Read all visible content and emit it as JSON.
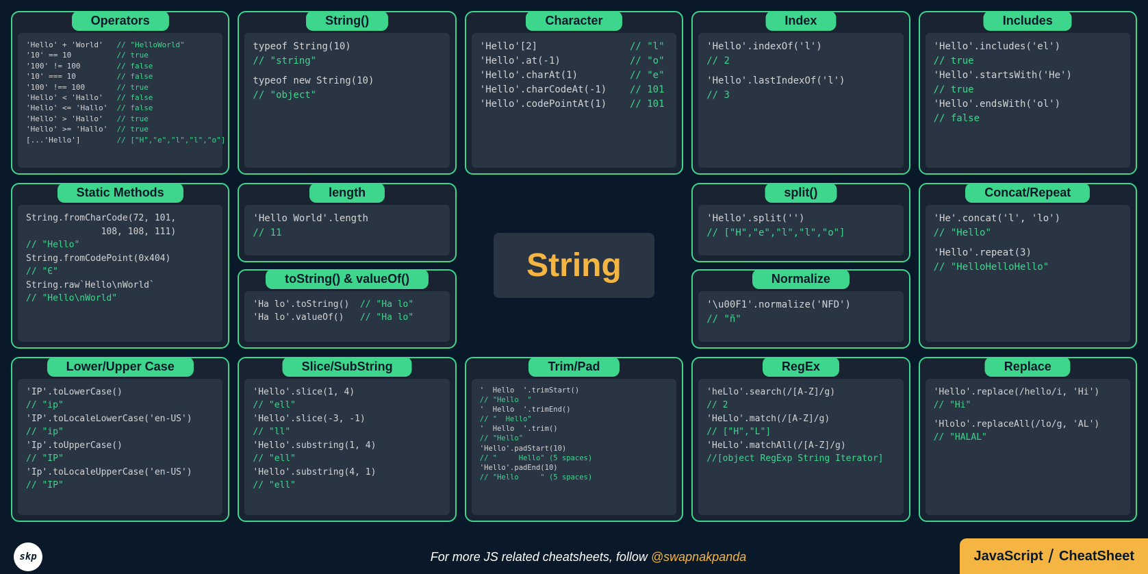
{
  "center_label": "String",
  "footer": {
    "text_prefix": "For more JS related cheatsheets, follow ",
    "handle": "@swapnakpanda",
    "badge_left": "JavaScript",
    "badge_right": "CheatSheet",
    "logo": "skp"
  },
  "cards": {
    "operators": {
      "title": "Operators",
      "lines": [
        {
          "code": "'Hello' + 'World'",
          "cmt": "// \"HelloWorld\""
        },
        {
          "code": "'10' == 10",
          "cmt": "// true"
        },
        {
          "code": "'100' != 100",
          "cmt": "// false"
        },
        {
          "code": "'10' === 10",
          "cmt": "// false"
        },
        {
          "code": "'100' !== 100",
          "cmt": "// true"
        },
        {
          "code": "'Hello' < 'Hallo'",
          "cmt": "// false"
        },
        {
          "code": "'Hello' <= 'Hallo'",
          "cmt": "// false"
        },
        {
          "code": "'Hello' > 'Hallo'",
          "cmt": "// true"
        },
        {
          "code": "'Hello' >= 'Hallo'",
          "cmt": "// true"
        },
        {
          "code": "[...'Hello']",
          "cmt": "// [\"H\",\"e\",\"l\",\"l\",\"o\"]"
        }
      ]
    },
    "string_ctor": {
      "title": "String()",
      "lines": [
        {
          "code": "typeof String(10)"
        },
        {
          "cmt": "// \"string\""
        },
        {
          "gap": true
        },
        {
          "code": "typeof new String(10)"
        },
        {
          "cmt": "// \"object\""
        }
      ]
    },
    "character": {
      "title": "Character",
      "lines": [
        {
          "code": "'Hello'[2]",
          "cmt": "// \"l\""
        },
        {
          "code": "'Hello'.at(-1)",
          "cmt": "// \"o\""
        },
        {
          "code": "'Hello'.charAt(1)",
          "cmt": "// \"e\""
        },
        {
          "code": "'Hello'.charCodeAt(-1)",
          "cmt": "// 101"
        },
        {
          "code": "'Hello'.codePointAt(1)",
          "cmt": "// 101"
        }
      ]
    },
    "index": {
      "title": "Index",
      "lines": [
        {
          "code": "'Hello'.indexOf('l')"
        },
        {
          "cmt": "// 2"
        },
        {
          "gap": true
        },
        {
          "code": "'Hello'.lastIndexOf('l')"
        },
        {
          "cmt": "// 3"
        }
      ]
    },
    "includes": {
      "title": "Includes",
      "lines": [
        {
          "code": "'Hello'.includes('el')"
        },
        {
          "cmt": "// true"
        },
        {
          "code": "'Hello'.startsWith('He')"
        },
        {
          "cmt": "// true"
        },
        {
          "code": "'Hello'.endsWith('ol')"
        },
        {
          "cmt": "// false"
        }
      ]
    },
    "static_methods": {
      "title": "Static Methods",
      "lines": [
        {
          "code": "String.fromCharCode(72, 101,"
        },
        {
          "code": "              108, 108, 111)"
        },
        {
          "cmt": "// \"Hello\""
        },
        {
          "code": "String.fromCodePoint(0x404)"
        },
        {
          "cmt": "// \"Є\""
        },
        {
          "code": "String.raw`Hello\\nWorld`"
        },
        {
          "cmt": "// \"Hello\\nWorld\""
        }
      ]
    },
    "length": {
      "title": "length",
      "lines": [
        {
          "code": "'Hello World'.length"
        },
        {
          "cmt": "// 11"
        }
      ]
    },
    "tostring": {
      "title": "toString() & valueOf()",
      "lines": [
        {
          "code": "'Ha lo'.toString()",
          "cmt": "// \"Ha lo\""
        },
        {
          "code": "'Ha lo'.valueOf()",
          "cmt": "// \"Ha lo\""
        }
      ]
    },
    "split": {
      "title": "split()",
      "lines": [
        {
          "code": "'Hello'.split('')"
        },
        {
          "cmt": "// [\"H\",\"e\",\"l\",\"l\",\"o\"]"
        }
      ]
    },
    "normalize": {
      "title": "Normalize",
      "lines": [
        {
          "code": "'\\u00F1'.normalize('NFD')"
        },
        {
          "cmt": "// \"ñ\""
        }
      ]
    },
    "concat": {
      "title": "Concat/Repeat",
      "lines": [
        {
          "code": "'He'.concat('l', 'lo')"
        },
        {
          "cmt": "// \"Hello\""
        },
        {
          "gap": true
        },
        {
          "code": "'Hello'.repeat(3)"
        },
        {
          "cmt": "// \"HelloHelloHello\""
        }
      ]
    },
    "case": {
      "title": "Lower/Upper Case",
      "lines": [
        {
          "code": "'IP'.toLowerCase()"
        },
        {
          "cmt": "// \"ip\""
        },
        {
          "code": "'IP'.toLocaleLowerCase('en-US')"
        },
        {
          "cmt": "// \"ip\""
        },
        {
          "code": "'Ip'.toUpperCase()"
        },
        {
          "cmt": "// \"IP\""
        },
        {
          "code": "'Ip'.toLocaleUpperCase('en-US')"
        },
        {
          "cmt": "// \"IP\""
        }
      ]
    },
    "slice": {
      "title": "Slice/SubString",
      "lines": [
        {
          "code": "'Hello'.slice(1, 4)"
        },
        {
          "cmt": "// \"ell\""
        },
        {
          "code": "'Hello'.slice(-3, -1)"
        },
        {
          "cmt": "// \"ll\""
        },
        {
          "code": "'Hello'.substring(1, 4)"
        },
        {
          "cmt": "// \"ell\""
        },
        {
          "code": "'Hello'.substring(4, 1)"
        },
        {
          "cmt": "// \"ell\""
        }
      ]
    },
    "trim": {
      "title": "Trim/Pad",
      "lines": [
        {
          "code": "'  Hello  '.trimStart()"
        },
        {
          "cmt": "// \"Hello  \""
        },
        {
          "code": "'  Hello  '.trimEnd()"
        },
        {
          "cmt": "// \"  Hello\""
        },
        {
          "code": "'  Hello  '.trim()"
        },
        {
          "cmt": "// \"Hello\""
        },
        {
          "code": "'Hello'.padStart(10)"
        },
        {
          "cmt": "// \"     Hello\" (5 spaces)"
        },
        {
          "code": "'Hello'.padEnd(10)"
        },
        {
          "cmt": "// \"Hello     \" (5 spaces)"
        }
      ]
    },
    "regex": {
      "title": "RegEx",
      "lines": [
        {
          "code": "'heLlo'.search(/[A-Z]/g)"
        },
        {
          "cmt": "// 2"
        },
        {
          "code": "'HeLlo'.match(/[A-Z]/g)"
        },
        {
          "cmt": "// [\"H\",\"L\"]"
        },
        {
          "code": "'HeLlo'.matchAll(/[A-Z]/g)"
        },
        {
          "cmt": "//[object RegExp String Iterator]"
        }
      ]
    },
    "replace": {
      "title": "Replace",
      "lines": [
        {
          "code": "'Hello'.replace(/hello/i, 'Hi')"
        },
        {
          "cmt": "// \"Hi\""
        },
        {
          "gap": true
        },
        {
          "code": "'Hlolo'.replaceAll(/lo/g, 'AL')"
        },
        {
          "cmt": "// \"HALAL\""
        }
      ]
    }
  }
}
